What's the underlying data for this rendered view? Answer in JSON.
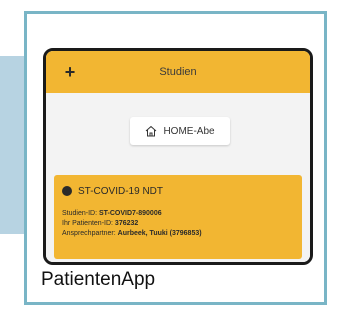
{
  "caption": "PatientenApp",
  "app": {
    "header_title": "Studien",
    "back_icon": "+",
    "home_button_label": "HOME-Abe",
    "study": {
      "title": "ST-COVID-19 NDT",
      "rows": [
        {
          "label": "Studien-ID: ",
          "value": "ST-COVID7-890006"
        },
        {
          "label": "Ihr Patienten-ID: ",
          "value": "376232"
        },
        {
          "label": "Ansprechpartner: ",
          "value": "Aurbeek, Tuuki (3796853)"
        }
      ]
    }
  },
  "colors": {
    "accent": "#f2b632",
    "frame_border": "#79b5c6",
    "side_strip": "#b7d3e2"
  }
}
